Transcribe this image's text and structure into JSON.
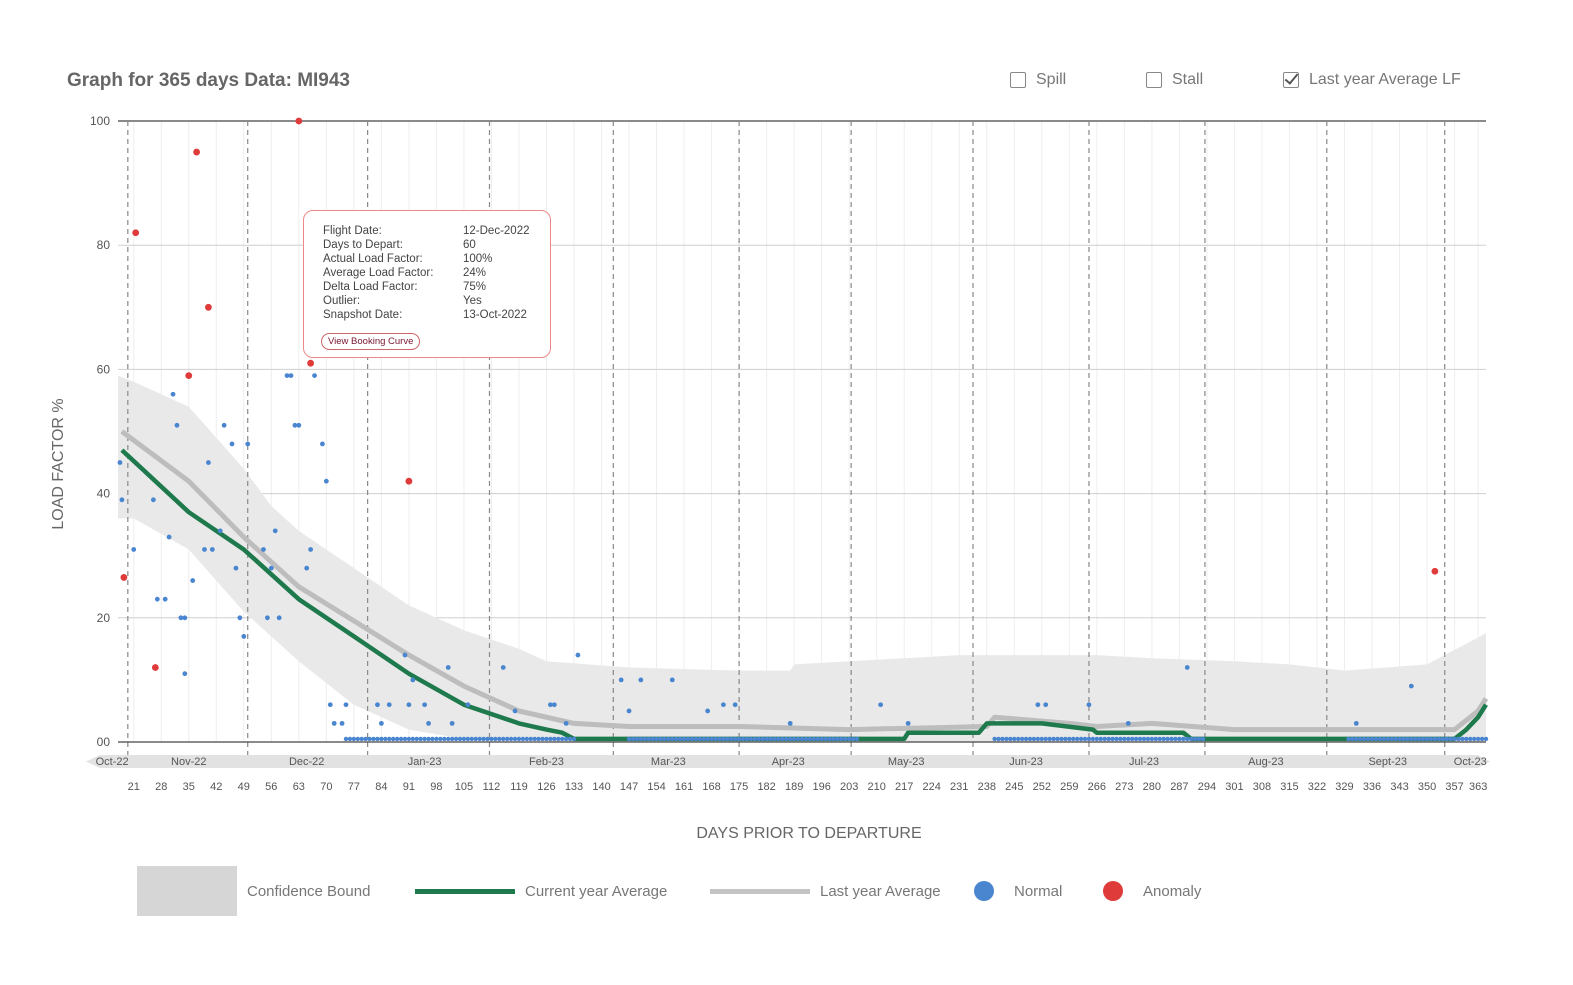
{
  "header": {
    "title": "Graph for 365 days Data: MI943",
    "options": [
      {
        "label": "Spill",
        "checked": false
      },
      {
        "label": "Stall",
        "checked": false
      },
      {
        "label": "Last year Average LF",
        "checked": true
      }
    ]
  },
  "tooltip": {
    "rows": [
      {
        "k": "Flight Date:",
        "v": "12-Dec-2022"
      },
      {
        "k": "Days to Depart:",
        "v": "60"
      },
      {
        "k": "Actual Load Factor:",
        "v": "100%"
      },
      {
        "k": "Average Load Factor:",
        "v": "24%"
      },
      {
        "k": "Delta Load Factor:",
        "v": "75%"
      },
      {
        "k": "Outlier:",
        "v": "Yes"
      },
      {
        "k": "Snapshot Date:",
        "v": "13-Oct-2022"
      }
    ],
    "button": "View Booking Curve"
  },
  "legend": {
    "bound": "Confidence Bound",
    "current": "Current year Average",
    "last": "Last year Average",
    "normal": "Normal",
    "anomaly": "Anomaly"
  },
  "colors": {
    "current": "#1e7a4c",
    "last": "#bdbdbd",
    "bound": "#e9e9e9",
    "normal": "#4a86d0",
    "anomaly": "#e03b3b"
  },
  "chart_data": {
    "type": "scatter",
    "title": "",
    "xlabel": "DAYS PRIOR TO DEPARTURE",
    "ylabel": "LOAD FACTOR %",
    "xlim": [
      17,
      365
    ],
    "ylim": [
      0,
      100
    ],
    "y_ticks": [
      "00",
      "20",
      "40",
      "60",
      "80",
      "100"
    ],
    "x_ticks": [
      21,
      28,
      35,
      42,
      49,
      56,
      63,
      70,
      77,
      84,
      91,
      98,
      105,
      112,
      119,
      126,
      133,
      140,
      147,
      154,
      161,
      168,
      175,
      182,
      189,
      196,
      203,
      210,
      217,
      224,
      231,
      238,
      245,
      252,
      259,
      266,
      273,
      280,
      287,
      294,
      301,
      308,
      315,
      322,
      329,
      336,
      343,
      350,
      357,
      363
    ],
    "months": [
      {
        "label": "Oct-22",
        "x": 15.5
      },
      {
        "label": "Nov-22",
        "x": 35
      },
      {
        "label": "Dec-22",
        "x": 65
      },
      {
        "label": "Jan-23",
        "x": 95
      },
      {
        "label": "Feb-23",
        "x": 126
      },
      {
        "label": "Mar-23",
        "x": 157
      },
      {
        "label": "Apr-23",
        "x": 187.5
      },
      {
        "label": "May-23",
        "x": 217.5
      },
      {
        "label": "Jun-23",
        "x": 248
      },
      {
        "label": "Jul-23",
        "x": 278
      },
      {
        "label": "Aug-23",
        "x": 309
      },
      {
        "label": "Sept-23",
        "x": 340
      },
      {
        "label": "Oct-23",
        "x": 361
      }
    ],
    "month_dividers": [
      19.5,
      50,
      80.5,
      111.5,
      143,
      175,
      203.5,
      234.5,
      264,
      293.5,
      324.5,
      354.5
    ],
    "grid": true,
    "legend_position": "bottom",
    "current_year_average": [
      [
        18,
        47
      ],
      [
        35,
        37
      ],
      [
        49,
        31
      ],
      [
        63,
        23
      ],
      [
        77,
        17
      ],
      [
        91,
        11
      ],
      [
        105,
        6
      ],
      [
        119,
        3
      ],
      [
        126,
        2
      ],
      [
        130,
        1.5
      ],
      [
        133,
        0.5
      ],
      [
        147,
        0.5
      ],
      [
        203,
        0.5
      ],
      [
        217,
        0.5
      ],
      [
        218,
        1.5
      ],
      [
        236,
        1.5
      ],
      [
        238,
        3
      ],
      [
        252,
        3
      ],
      [
        265,
        2
      ],
      [
        266,
        1.5
      ],
      [
        288,
        1.5
      ],
      [
        290,
        0.5
      ],
      [
        357,
        0.5
      ],
      [
        360,
        2
      ],
      [
        363,
        4
      ],
      [
        365,
        6
      ]
    ],
    "last_year_average": [
      [
        18,
        50
      ],
      [
        35,
        42
      ],
      [
        49,
        33
      ],
      [
        63,
        25
      ],
      [
        77,
        19.5
      ],
      [
        91,
        14
      ],
      [
        105,
        9
      ],
      [
        119,
        5
      ],
      [
        133,
        3
      ],
      [
        147,
        2.5
      ],
      [
        175,
        2.5
      ],
      [
        203,
        2
      ],
      [
        238,
        2.5
      ],
      [
        240,
        4
      ],
      [
        259,
        3
      ],
      [
        266,
        2.5
      ],
      [
        280,
        3
      ],
      [
        301,
        2
      ],
      [
        357,
        2
      ],
      [
        363,
        5
      ],
      [
        365,
        7
      ]
    ],
    "confidence_upper": [
      [
        17,
        59
      ],
      [
        21,
        58
      ],
      [
        35,
        54
      ],
      [
        49,
        44
      ],
      [
        56,
        38
      ],
      [
        63,
        34
      ],
      [
        77,
        28
      ],
      [
        91,
        22
      ],
      [
        105,
        18
      ],
      [
        119,
        15
      ],
      [
        126,
        13
      ],
      [
        147,
        12
      ],
      [
        175,
        11.5
      ],
      [
        188,
        11.5
      ],
      [
        189,
        12.5
      ],
      [
        217,
        13.5
      ],
      [
        231,
        14
      ],
      [
        266,
        14
      ],
      [
        280,
        13.5
      ],
      [
        301,
        13
      ],
      [
        315,
        12.5
      ],
      [
        329,
        11.5
      ],
      [
        350,
        12.5
      ],
      [
        365,
        17.5
      ]
    ],
    "confidence_lower": [
      [
        17,
        36
      ],
      [
        21,
        36
      ],
      [
        35,
        31
      ],
      [
        49,
        21
      ],
      [
        63,
        13
      ],
      [
        77,
        6
      ],
      [
        91,
        2
      ],
      [
        105,
        0.5
      ],
      [
        133,
        0
      ],
      [
        365,
        0
      ]
    ],
    "normal_points": [
      [
        17.5,
        45
      ],
      [
        18,
        39
      ],
      [
        21,
        31
      ],
      [
        26,
        39
      ],
      [
        27,
        23
      ],
      [
        29,
        23
      ],
      [
        30,
        33
      ],
      [
        31,
        56
      ],
      [
        32,
        51
      ],
      [
        33,
        20
      ],
      [
        34,
        20
      ],
      [
        34,
        11
      ],
      [
        36,
        26
      ],
      [
        39,
        31
      ],
      [
        40,
        45
      ],
      [
        41,
        31
      ],
      [
        43,
        34
      ],
      [
        44,
        51
      ],
      [
        46,
        48
      ],
      [
        47,
        28
      ],
      [
        48,
        20
      ],
      [
        49,
        17
      ],
      [
        50,
        48
      ],
      [
        54,
        31
      ],
      [
        55,
        20
      ],
      [
        56,
        28
      ],
      [
        57,
        34
      ],
      [
        58,
        20
      ],
      [
        60,
        59
      ],
      [
        61,
        59
      ],
      [
        62,
        51
      ],
      [
        63,
        51
      ],
      [
        65,
        28
      ],
      [
        66,
        31
      ],
      [
        67,
        59
      ],
      [
        69,
        48
      ],
      [
        70,
        42
      ],
      [
        71,
        6
      ],
      [
        72,
        3
      ],
      [
        74,
        3
      ],
      [
        75,
        6
      ],
      [
        83,
        6
      ],
      [
        84,
        3
      ],
      [
        86,
        6
      ],
      [
        90,
        14
      ],
      [
        91,
        6
      ],
      [
        92,
        10
      ],
      [
        95,
        6
      ],
      [
        96,
        3
      ],
      [
        101,
        12
      ],
      [
        102,
        3
      ],
      [
        106,
        6
      ],
      [
        115,
        12
      ],
      [
        118,
        5
      ],
      [
        127,
        6
      ],
      [
        128,
        6
      ],
      [
        131,
        3
      ],
      [
        134,
        14
      ],
      [
        145,
        10
      ],
      [
        147,
        5
      ],
      [
        150,
        10
      ],
      [
        158,
        10
      ],
      [
        167,
        5
      ],
      [
        171,
        6
      ],
      [
        174,
        6
      ],
      [
        188,
        3
      ],
      [
        211,
        6
      ],
      [
        218,
        3
      ],
      [
        251,
        6
      ],
      [
        253,
        6
      ],
      [
        264,
        6
      ],
      [
        274,
        3
      ],
      [
        289,
        12
      ],
      [
        332,
        3
      ],
      [
        346,
        9
      ]
    ],
    "baseline_ranges": [
      [
        75,
        133
      ],
      [
        147,
        205
      ],
      [
        240,
        293
      ],
      [
        330,
        365
      ]
    ],
    "baseline_value": 0.5,
    "anomaly_points": [
      [
        18.5,
        26.5
      ],
      [
        21.5,
        82
      ],
      [
        26.5,
        12
      ],
      [
        35,
        59
      ],
      [
        37,
        95
      ],
      [
        40,
        70
      ],
      [
        63,
        100
      ],
      [
        66,
        61
      ],
      [
        91,
        42
      ],
      [
        352,
        27.5
      ]
    ]
  }
}
